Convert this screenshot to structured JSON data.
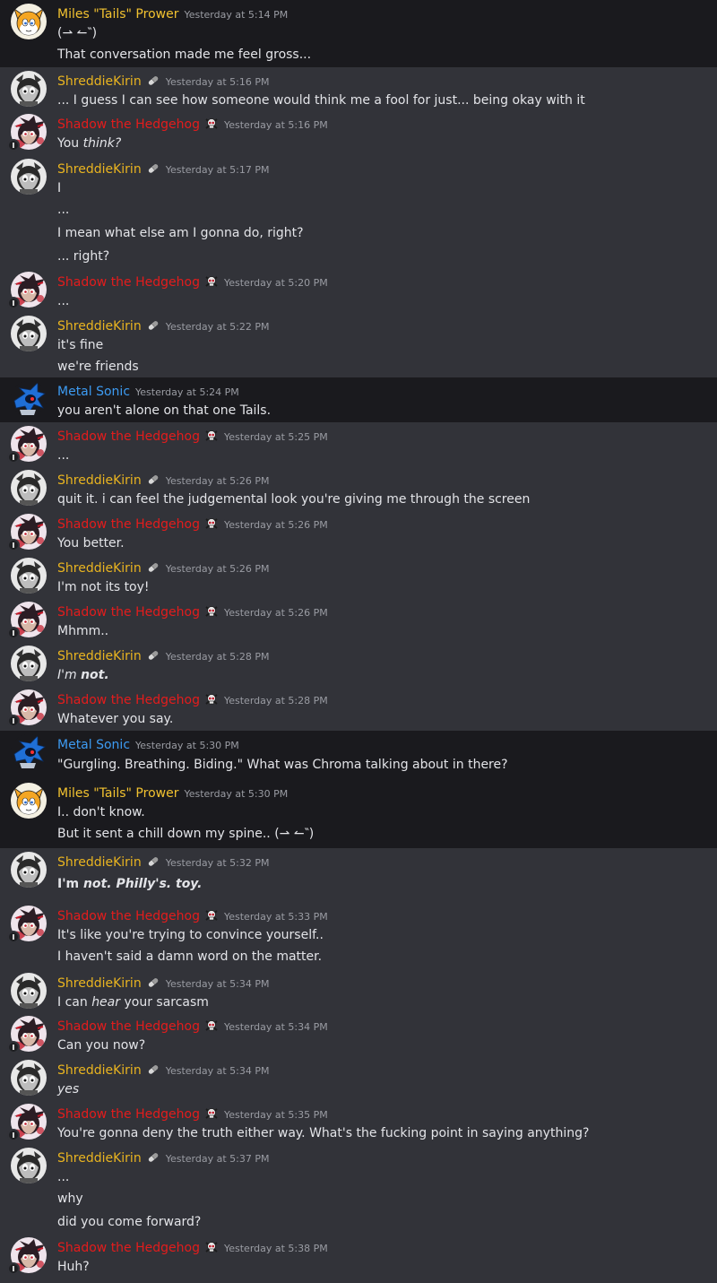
{
  "messages": [
    {
      "author": "Miles \"Tails\" Prower",
      "time": "Yesterday at 5:14 PM",
      "lines": [
        "(⇀ ↼‶)",
        "That conversation made me feel gross..."
      ]
    },
    {
      "author": "ShreddieKirin",
      "time": "Yesterday at 5:16 PM",
      "lines": [
        "... I guess I can see how someone would think me a fool for just... being okay with it"
      ]
    },
    {
      "author": "Shadow the Hedgehog",
      "time": "Yesterday at 5:16 PM",
      "line_parts": [
        [
          "You ",
          "think?"
        ]
      ]
    },
    {
      "author": "ShreddieKirin",
      "time": "Yesterday at 5:17 PM",
      "lines": [
        "I",
        "...",
        "I mean what else am I gonna do, right?",
        "... right?"
      ]
    },
    {
      "author": "Shadow the Hedgehog",
      "time": "Yesterday at 5:20 PM",
      "lines": [
        "..."
      ]
    },
    {
      "author": "ShreddieKirin",
      "time": "Yesterday at 5:22 PM",
      "lines": [
        "it's fine",
        "we're friends"
      ]
    },
    {
      "author": "Metal Sonic",
      "time": "Yesterday at 5:24 PM",
      "lines": [
        "you aren't alone on that one Tails."
      ]
    },
    {
      "author": "Shadow the Hedgehog",
      "time": "Yesterday at 5:25 PM",
      "lines": [
        "..."
      ]
    },
    {
      "author": "ShreddieKirin",
      "time": "Yesterday at 5:26 PM",
      "lines": [
        "quit it. i can feel the judgemental look you're giving me through the screen"
      ]
    },
    {
      "author": "Shadow the Hedgehog",
      "time": "Yesterday at 5:26 PM",
      "lines": [
        "You better."
      ]
    },
    {
      "author": "ShreddieKirin",
      "time": "Yesterday at 5:26 PM",
      "lines": [
        "I'm not its toy!"
      ]
    },
    {
      "author": "Shadow the Hedgehog",
      "time": "Yesterday at 5:26 PM",
      "lines": [
        "Mhmm.."
      ]
    },
    {
      "author": "ShreddieKirin",
      "time": "Yesterday at 5:28 PM",
      "line_parts": [
        [
          "I'm ",
          "not."
        ]
      ]
    },
    {
      "author": "Shadow the Hedgehog",
      "time": "Yesterday at 5:28 PM",
      "lines": [
        "Whatever you say."
      ]
    },
    {
      "author": "Metal Sonic",
      "time": "Yesterday at 5:30 PM",
      "lines": [
        "\"Gurgling. Breathing. Biding.\" What was Chroma talking about in there?"
      ]
    },
    {
      "author": "Miles \"Tails\" Prower",
      "time": "Yesterday at 5:30 PM",
      "lines": [
        "I.. don't know.",
        "But it sent a chill down my spine.. (⇀ ↼‶)"
      ]
    },
    {
      "author": "ShreddieKirin",
      "time": "Yesterday at 5:32 PM",
      "line_parts": [
        [
          "I'm ",
          "not. Philly's. toy."
        ]
      ]
    },
    {
      "author": "Shadow the Hedgehog",
      "time": "Yesterday at 5:33 PM",
      "lines": [
        "It's like you're trying to convince yourself..",
        "I haven't said a damn word on the matter."
      ]
    },
    {
      "author": "ShreddieKirin",
      "time": "Yesterday at 5:34 PM",
      "line_parts": [
        [
          "I can ",
          "hear",
          " your sarcasm"
        ]
      ]
    },
    {
      "author": "Shadow the Hedgehog",
      "time": "Yesterday at 5:34 PM",
      "lines": [
        "Can you now?"
      ]
    },
    {
      "author": "ShreddieKirin",
      "time": "Yesterday at 5:34 PM",
      "lines": [
        "yes"
      ]
    },
    {
      "author": "Shadow the Hedgehog",
      "time": "Yesterday at 5:35 PM",
      "lines": [
        "You're gonna deny the truth either way. What's the fucking point in saying anything?"
      ]
    },
    {
      "author": "ShreddieKirin",
      "time": "Yesterday at 5:37 PM",
      "lines": [
        "...",
        "why",
        "did you come forward?"
      ]
    },
    {
      "author": "Shadow the Hedgehog",
      "time": "Yesterday at 5:38 PM",
      "lines": [
        "Huh?"
      ]
    }
  ],
  "colors": {
    "background": "#323339",
    "background_dark": "#1a1a1e",
    "tails": "#f2c230",
    "shreddie": "#e9b420",
    "shadow": "#e41c1c",
    "metal": "#3d9bf2",
    "text": "#e3e4e8",
    "timestamp": "#9a9ca3"
  },
  "icons": {
    "shreddie_tag": "pill-icon",
    "shadow_tag": "skull-crossbones-icon"
  }
}
